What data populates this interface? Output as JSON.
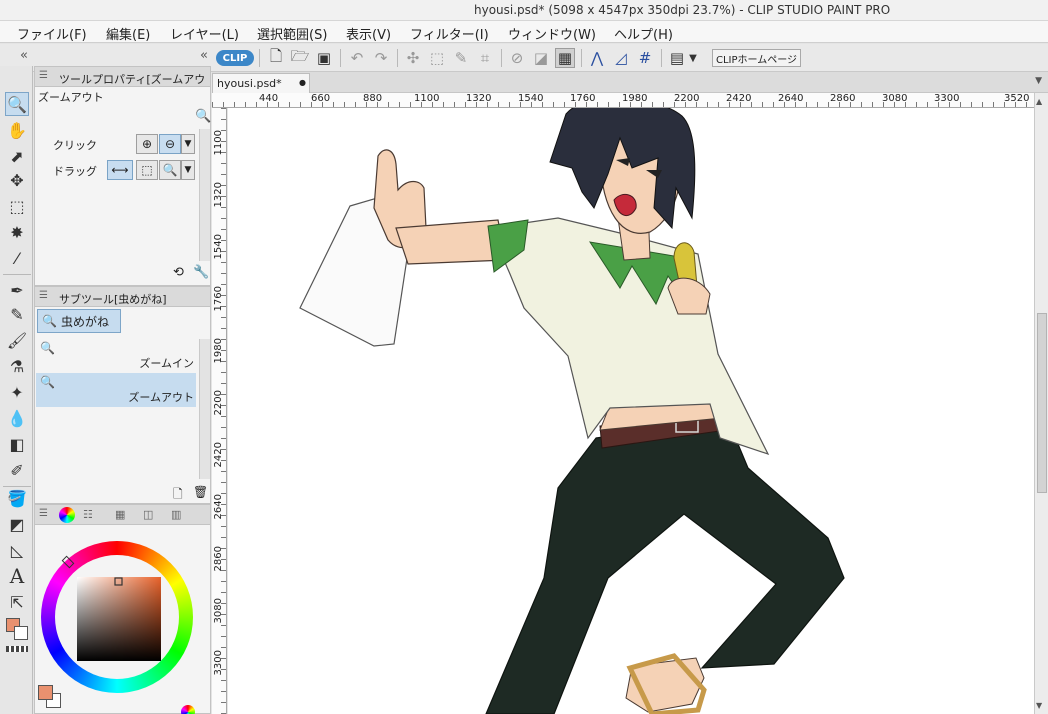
{
  "window": {
    "title": "hyousi.psd* (5098 x 4547px 350dpi 23.7%)  - CLIP STUDIO PAINT PRO"
  },
  "menu": [
    "ファイル(F)",
    "編集(E)",
    "レイヤー(L)",
    "選択範囲(S)",
    "表示(V)",
    "フィルター(I)",
    "ウィンドウ(W)",
    "ヘルプ(H)"
  ],
  "toolbar": {
    "logo_label": "CLIP",
    "home_button": "CLIPホームページ"
  },
  "tool_property": {
    "header": "ツールプロパティ[ズームアウ",
    "tool_name": "ズームアウト",
    "click_label": "クリック",
    "drag_label": "ドラッグ"
  },
  "sub_tool": {
    "header": "サブツール[虫めがね]",
    "group_label": "虫めがね",
    "items": [
      "ズームイン",
      "ズームアウト"
    ]
  },
  "document": {
    "tab_label": "hyousi.psd*"
  },
  "ruler": {
    "top_ticks": [
      "440",
      "660",
      "880",
      "1100",
      "1320",
      "1540",
      "1760",
      "1980",
      "2200",
      "2420",
      "2640",
      "2860",
      "3080",
      "3300",
      "3520"
    ],
    "left_ticks": [
      "1100",
      "1320",
      "1540",
      "1760",
      "1980",
      "2200",
      "2420",
      "2640",
      "2860",
      "3080",
      "3300"
    ]
  },
  "colors": {
    "main_color": "#e9916f",
    "sub_color": "#ffffff",
    "shirt": "#f1f2e0",
    "shirt_accent": "#4aa046",
    "pants": "#1e2a24",
    "hair": "#2a2e3c",
    "skin": "#f5d2b6"
  }
}
